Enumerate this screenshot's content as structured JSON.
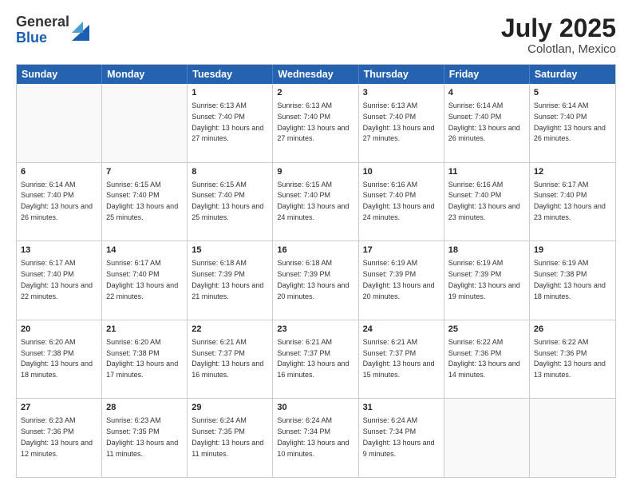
{
  "logo": {
    "general": "General",
    "blue": "Blue"
  },
  "title": {
    "month_year": "July 2025",
    "location": "Colotlan, Mexico"
  },
  "header_days": [
    "Sunday",
    "Monday",
    "Tuesday",
    "Wednesday",
    "Thursday",
    "Friday",
    "Saturday"
  ],
  "weeks": [
    [
      {
        "day": "",
        "info": ""
      },
      {
        "day": "",
        "info": ""
      },
      {
        "day": "1",
        "info": "Sunrise: 6:13 AM\nSunset: 7:40 PM\nDaylight: 13 hours and 27 minutes."
      },
      {
        "day": "2",
        "info": "Sunrise: 6:13 AM\nSunset: 7:40 PM\nDaylight: 13 hours and 27 minutes."
      },
      {
        "day": "3",
        "info": "Sunrise: 6:13 AM\nSunset: 7:40 PM\nDaylight: 13 hours and 27 minutes."
      },
      {
        "day": "4",
        "info": "Sunrise: 6:14 AM\nSunset: 7:40 PM\nDaylight: 13 hours and 26 minutes."
      },
      {
        "day": "5",
        "info": "Sunrise: 6:14 AM\nSunset: 7:40 PM\nDaylight: 13 hours and 26 minutes."
      }
    ],
    [
      {
        "day": "6",
        "info": "Sunrise: 6:14 AM\nSunset: 7:40 PM\nDaylight: 13 hours and 26 minutes."
      },
      {
        "day": "7",
        "info": "Sunrise: 6:15 AM\nSunset: 7:40 PM\nDaylight: 13 hours and 25 minutes."
      },
      {
        "day": "8",
        "info": "Sunrise: 6:15 AM\nSunset: 7:40 PM\nDaylight: 13 hours and 25 minutes."
      },
      {
        "day": "9",
        "info": "Sunrise: 6:15 AM\nSunset: 7:40 PM\nDaylight: 13 hours and 24 minutes."
      },
      {
        "day": "10",
        "info": "Sunrise: 6:16 AM\nSunset: 7:40 PM\nDaylight: 13 hours and 24 minutes."
      },
      {
        "day": "11",
        "info": "Sunrise: 6:16 AM\nSunset: 7:40 PM\nDaylight: 13 hours and 23 minutes."
      },
      {
        "day": "12",
        "info": "Sunrise: 6:17 AM\nSunset: 7:40 PM\nDaylight: 13 hours and 23 minutes."
      }
    ],
    [
      {
        "day": "13",
        "info": "Sunrise: 6:17 AM\nSunset: 7:40 PM\nDaylight: 13 hours and 22 minutes."
      },
      {
        "day": "14",
        "info": "Sunrise: 6:17 AM\nSunset: 7:40 PM\nDaylight: 13 hours and 22 minutes."
      },
      {
        "day": "15",
        "info": "Sunrise: 6:18 AM\nSunset: 7:39 PM\nDaylight: 13 hours and 21 minutes."
      },
      {
        "day": "16",
        "info": "Sunrise: 6:18 AM\nSunset: 7:39 PM\nDaylight: 13 hours and 20 minutes."
      },
      {
        "day": "17",
        "info": "Sunrise: 6:19 AM\nSunset: 7:39 PM\nDaylight: 13 hours and 20 minutes."
      },
      {
        "day": "18",
        "info": "Sunrise: 6:19 AM\nSunset: 7:39 PM\nDaylight: 13 hours and 19 minutes."
      },
      {
        "day": "19",
        "info": "Sunrise: 6:19 AM\nSunset: 7:38 PM\nDaylight: 13 hours and 18 minutes."
      }
    ],
    [
      {
        "day": "20",
        "info": "Sunrise: 6:20 AM\nSunset: 7:38 PM\nDaylight: 13 hours and 18 minutes."
      },
      {
        "day": "21",
        "info": "Sunrise: 6:20 AM\nSunset: 7:38 PM\nDaylight: 13 hours and 17 minutes."
      },
      {
        "day": "22",
        "info": "Sunrise: 6:21 AM\nSunset: 7:37 PM\nDaylight: 13 hours and 16 minutes."
      },
      {
        "day": "23",
        "info": "Sunrise: 6:21 AM\nSunset: 7:37 PM\nDaylight: 13 hours and 16 minutes."
      },
      {
        "day": "24",
        "info": "Sunrise: 6:21 AM\nSunset: 7:37 PM\nDaylight: 13 hours and 15 minutes."
      },
      {
        "day": "25",
        "info": "Sunrise: 6:22 AM\nSunset: 7:36 PM\nDaylight: 13 hours and 14 minutes."
      },
      {
        "day": "26",
        "info": "Sunrise: 6:22 AM\nSunset: 7:36 PM\nDaylight: 13 hours and 13 minutes."
      }
    ],
    [
      {
        "day": "27",
        "info": "Sunrise: 6:23 AM\nSunset: 7:36 PM\nDaylight: 13 hours and 12 minutes."
      },
      {
        "day": "28",
        "info": "Sunrise: 6:23 AM\nSunset: 7:35 PM\nDaylight: 13 hours and 11 minutes."
      },
      {
        "day": "29",
        "info": "Sunrise: 6:24 AM\nSunset: 7:35 PM\nDaylight: 13 hours and 11 minutes."
      },
      {
        "day": "30",
        "info": "Sunrise: 6:24 AM\nSunset: 7:34 PM\nDaylight: 13 hours and 10 minutes."
      },
      {
        "day": "31",
        "info": "Sunrise: 6:24 AM\nSunset: 7:34 PM\nDaylight: 13 hours and 9 minutes."
      },
      {
        "day": "",
        "info": ""
      },
      {
        "day": "",
        "info": ""
      }
    ]
  ]
}
